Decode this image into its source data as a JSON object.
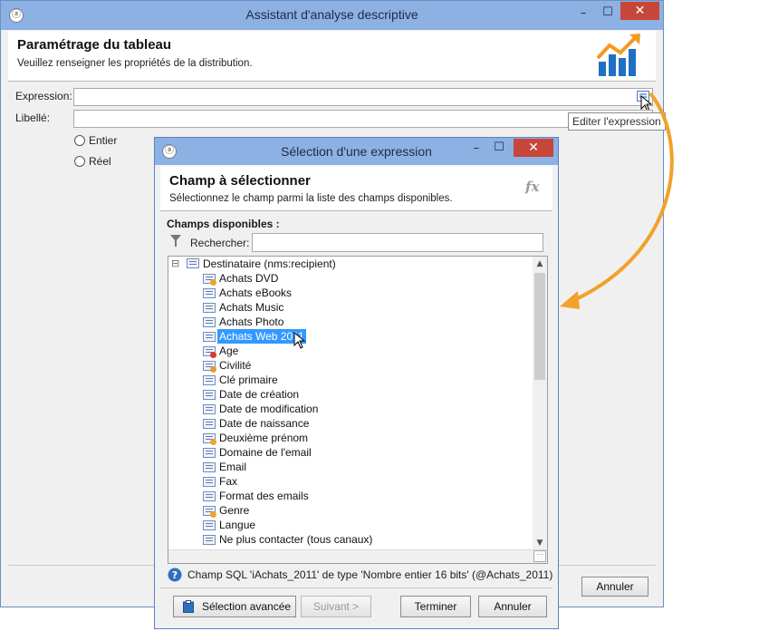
{
  "main_window": {
    "title": "Assistant d'analyse descriptive",
    "controls": {
      "minimize": "–",
      "maximize": "☐",
      "close": "✕"
    },
    "header_title": "Paramétrage du tableau",
    "header_subtitle": "Veuillez renseigner les propriétés de la distribution.",
    "expression_label": "Expression:",
    "expression_value": "",
    "libelle_label": "Libellé:",
    "libelle_value": "",
    "radio_entier": "Entier",
    "radio_reel": "Réel",
    "cancel_label": "Annuler",
    "tooltip": "Editer l'expression"
  },
  "dialog": {
    "title": "Sélection d'une expression",
    "controls": {
      "minimize": "–",
      "maximize": "☐",
      "close": "✕"
    },
    "header_title": "Champ à sélectionner",
    "header_subtitle": "Sélectionnez le champ parmi la liste des champs disponibles.",
    "fx_label": "fx",
    "champs_label": "Champs disponibles :",
    "search_label": "Rechercher:",
    "search_value": "",
    "tree_root": "Destinataire (nms:recipient)",
    "tree_toggle": "⊟",
    "tree_items": [
      {
        "label": "Achats DVD",
        "badge": "link"
      },
      {
        "label": "Achats eBooks",
        "badge": "none"
      },
      {
        "label": "Achats Music",
        "badge": "none"
      },
      {
        "label": "Achats Photo",
        "badge": "none"
      },
      {
        "label": "Achats Web 2011",
        "badge": "none",
        "selected": true
      },
      {
        "label": "Age",
        "badge": "formula"
      },
      {
        "label": "Civilité",
        "badge": "enum"
      },
      {
        "label": "Clé primaire",
        "badge": "none"
      },
      {
        "label": "Date de création",
        "badge": "none"
      },
      {
        "label": "Date de modification",
        "badge": "none"
      },
      {
        "label": "Date de naissance",
        "badge": "none"
      },
      {
        "label": "Deuxième prénom",
        "badge": "link"
      },
      {
        "label": "Domaine de l'email",
        "badge": "none"
      },
      {
        "label": "Email",
        "badge": "none"
      },
      {
        "label": "Fax",
        "badge": "none"
      },
      {
        "label": "Format des emails",
        "badge": "none"
      },
      {
        "label": "Genre",
        "badge": "link"
      },
      {
        "label": "Langue",
        "badge": "none"
      },
      {
        "label": "Ne plus contacter (tous canaux)",
        "badge": "none"
      }
    ],
    "status_text": "Champ SQL 'iAchats_2011' de type 'Nombre entier 16 bits' (@Achats_2011)",
    "btn_advanced": "Sélection avancée",
    "btn_next": "Suivant >",
    "btn_finish": "Terminer",
    "btn_cancel": "Annuler"
  },
  "colors": {
    "titlebar": "#8cb1e2",
    "close": "#c7463a",
    "selection": "#3399ff",
    "arrow": "#f0a22a",
    "chart_blue": "#1f6fc4",
    "chart_orange": "#f39a1f"
  }
}
